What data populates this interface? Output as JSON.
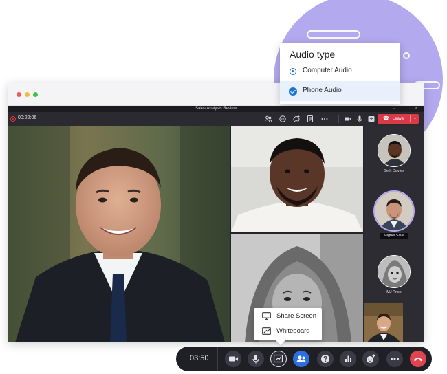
{
  "meeting": {
    "window_title": "Sales Analysis Review",
    "elapsed_time": "00:22:06",
    "leave_label": "Leave"
  },
  "window_controls": {
    "minimize": "–",
    "maximize": "□",
    "close": "✕"
  },
  "toolbar_icons": [
    "participants-icon",
    "chat-icon",
    "reactions-icon",
    "notes-icon",
    "more-icon",
    "camera-icon",
    "microphone-icon",
    "share-icon"
  ],
  "participants": [
    {
      "name": "Beth Davies"
    },
    {
      "name": "Miguel Silva",
      "active": true
    },
    {
      "name": "MJ Price"
    }
  ],
  "audio_menu": {
    "title": "Audio type",
    "options": [
      {
        "label": "Computer Audio",
        "selected": false
      },
      {
        "label": "Phone Audio",
        "selected": true
      }
    ]
  },
  "share_menu": {
    "items": [
      {
        "label": "Share Screen",
        "icon": "monitor-icon"
      },
      {
        "label": "Whiteboard",
        "icon": "whiteboard-icon"
      }
    ]
  },
  "control_bar": {
    "timer": "03:50",
    "buttons": [
      "camera-icon",
      "microphone-icon",
      "share-screen-icon",
      "participants-icon",
      "help-icon",
      "poll-icon",
      "reactions-icon",
      "more-icon",
      "end-call-icon"
    ]
  },
  "colors": {
    "accent_blue": "#2b6fe0",
    "leave_red": "#d93a45",
    "deco_purple": "#b3a9ef",
    "control_bar": "#1f2026"
  }
}
